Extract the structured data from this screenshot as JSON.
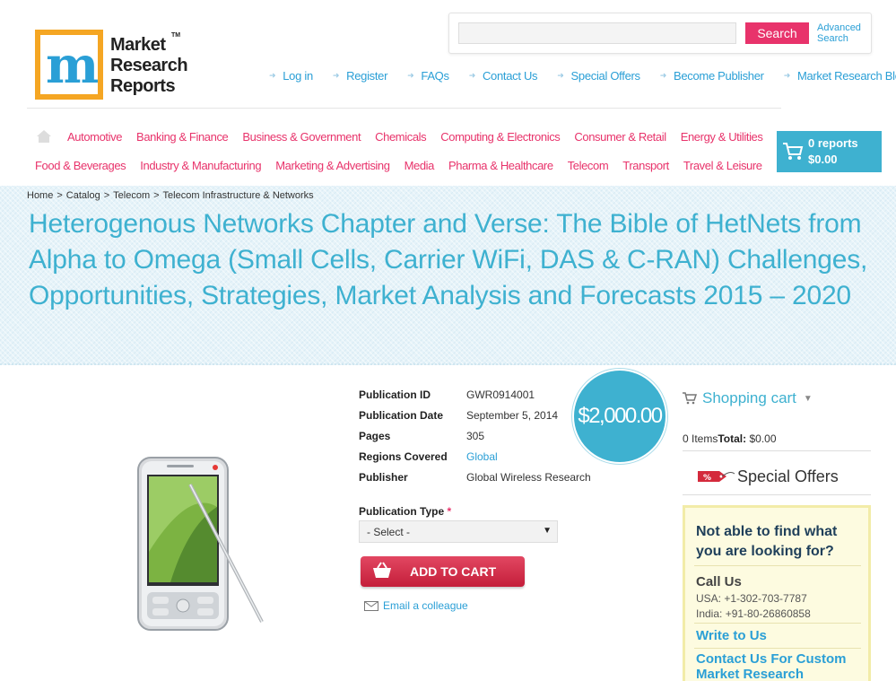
{
  "logo": {
    "line1": "Market",
    "line2": "Research",
    "line3": "Reports",
    "tm": "TM",
    "mark": "m"
  },
  "search": {
    "placeholder": "",
    "button": "Search",
    "advanced": "Advanced Search"
  },
  "toplinks": [
    "Log in",
    "Register",
    "FAQs",
    "Contact Us",
    "Special Offers",
    "Become Publisher",
    "Market Research Blog"
  ],
  "categories_row1": [
    "Automotive",
    "Banking & Finance",
    "Business & Government",
    "Chemicals",
    "Computing & Electronics",
    "Consumer & Retail",
    "Energy & Utilities"
  ],
  "categories_row2": [
    "Food & Beverages",
    "Industry & Manufacturing",
    "Marketing & Advertising",
    "Media",
    "Pharma & Healthcare",
    "Telecom",
    "Transport",
    "Travel & Leisure"
  ],
  "cart_button": {
    "reports": "0 reports",
    "amount": "$0.00"
  },
  "breadcrumb": [
    "Home",
    "Catalog",
    "Telecom",
    "Telecom Infrastructure & Networks"
  ],
  "title": "Heterogenous Networks Chapter and Verse: The Bible of HetNets from Alpha to Omega (Small Cells, Carrier WiFi, DAS & C-RAN) Challenges, Opportunities, Strategies, Market Analysis and Forecasts 2015 – 2020",
  "product": {
    "specs": [
      {
        "label": "Publication ID",
        "value": "GWR0914001"
      },
      {
        "label": "Publication Date",
        "value": "September 5, 2014"
      },
      {
        "label": "Pages",
        "value": "305"
      },
      {
        "label": "Regions Covered",
        "value": "Global"
      },
      {
        "label": "Publisher",
        "value": "Global Wireless Research"
      }
    ],
    "price": "$2,000.00",
    "pubtype_label": "Publication Type",
    "required_mark": "*",
    "select_value": "- Select -",
    "add_to_cart": "ADD TO CART",
    "email": "Email a colleague"
  },
  "sidebar": {
    "cart_title": "Shopping cart",
    "items_text": "0 Items",
    "total_label": "Total:",
    "total_value": "$0.00",
    "special_offers": "Special Offers",
    "help_question": "Not able to find what you are looking for?",
    "call_us": "Call Us",
    "phone_usa": "USA: +1-302-703-7787",
    "phone_india": "India: +91-80-26860858",
    "write_to_us": "Write to Us",
    "custom_research": "Contact Us For Custom Market Research"
  },
  "colors": {
    "accent_blue": "#3eb1d0",
    "accent_pink": "#e8336b",
    "link_blue": "#2a9fd6",
    "logo_orange": "#f5a623"
  }
}
